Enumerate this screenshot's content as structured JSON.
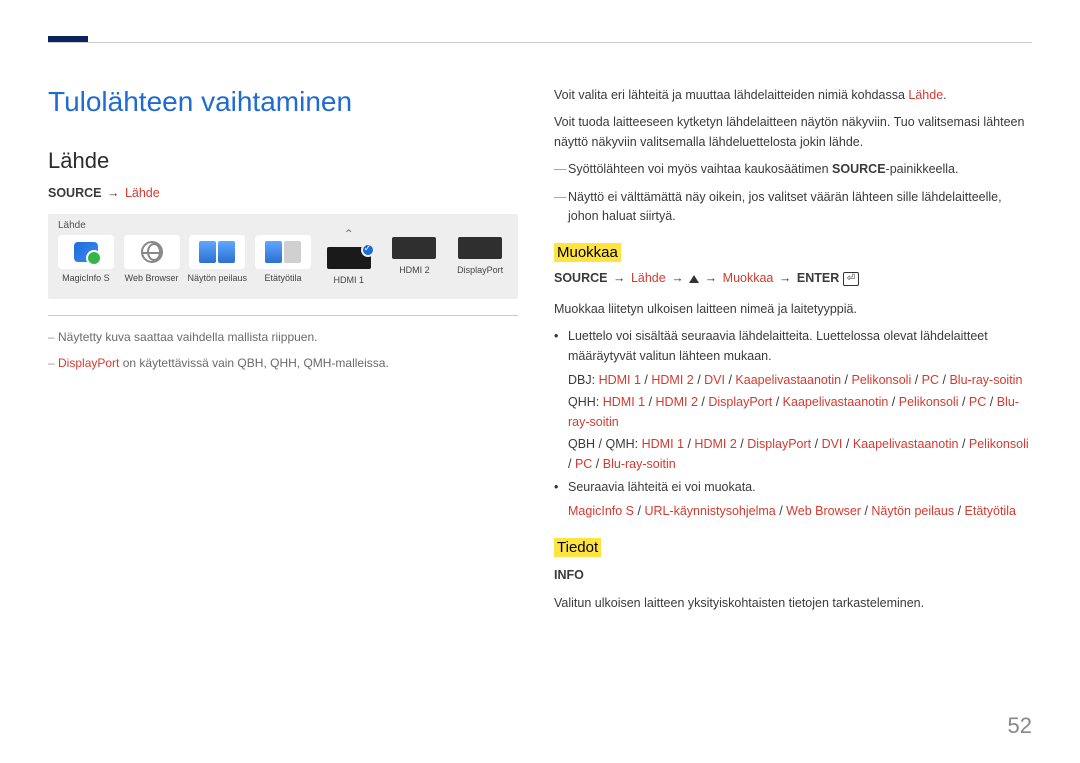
{
  "page_number": "52",
  "left": {
    "h1": "Tulolähteen vaihtaminen",
    "h2": "Lähde",
    "breadcrumb": {
      "source": "SOURCE",
      "target": "Lähde"
    },
    "panel_title": "Lähde",
    "sources": [
      {
        "label": "MagicInfo S"
      },
      {
        "label": "Web Browser"
      },
      {
        "label": "Näytön peilaus"
      },
      {
        "label": "Etätyötila"
      },
      {
        "label": "HDMI 1"
      },
      {
        "label": "HDMI 2"
      },
      {
        "label": "DisplayPort"
      }
    ],
    "notes": {
      "n1": "Näytetty kuva saattaa vaihdella mallista riippuen.",
      "n2a": "DisplayPort",
      "n2b": " on käytettävissä vain QBH, QHH, QMH-malleissa."
    }
  },
  "right": {
    "intro1a": "Voit valita eri lähteitä ja muuttaa lähdelaitteiden nimiä kohdassa ",
    "intro1b": "Lähde",
    "intro1c": ".",
    "intro2": "Voit tuoda laitteeseen kytketyn lähdelaitteen näytön näkyviin. Tuo valitsemasi lähteen näyttö näkyviin valitsemalla lähdeluettelosta jokin lähde.",
    "dash1a": "Syöttölähteen voi myös vaihtaa kaukosäätimen ",
    "dash1b": "SOURCE",
    "dash1c": "-painikkeella.",
    "dash2": "Näyttö ei välttämättä näy oikein, jos valitset väärän lähteen sille lähdelaitteelle, johon haluat siirtyä.",
    "muokkaa": {
      "title": "Muokkaa",
      "path": {
        "source": "SOURCE",
        "lahde": "Lähde",
        "muokkaa": "Muokkaa",
        "enter": "ENTER"
      },
      "desc": "Muokkaa liitetyn ulkoisen laitteen nimeä ja laitetyyppiä.",
      "b1": "Luettelo voi sisältää seuraavia lähdelaitteita. Luettelossa olevat lähdelaitteet määräytyvät valitun lähteen mukaan.",
      "dbj_label": "DBJ: ",
      "dbj_items": [
        "HDMI 1",
        "HDMI 2",
        "DVI",
        "Kaapelivastaanotin",
        "Pelikonsoli",
        "PC",
        "Blu-ray-soitin"
      ],
      "qhh_label": "QHH: ",
      "qhh_items": [
        "HDMI 1",
        "HDMI 2",
        "DisplayPort",
        "Kaapelivastaanotin",
        "Pelikonsoli",
        "PC",
        "Blu-ray-soitin"
      ],
      "qbh_label": "QBH / QMH: ",
      "qbh_items": [
        "HDMI 1",
        "HDMI 2",
        "DisplayPort",
        "DVI",
        "Kaapelivastaanotin",
        "Pelikonsoli",
        "PC",
        "Blu-ray-soitin"
      ],
      "b2": "Seuraavia lähteitä ei voi muokata.",
      "nomod_items": [
        "MagicInfo S",
        "URL-käynnistysohjelma",
        "Web Browser",
        "Näytön peilaus",
        "Etätyötila"
      ]
    },
    "tiedot": {
      "title": "Tiedot",
      "info": "INFO",
      "desc": "Valitun ulkoisen laitteen yksityiskohtaisten tietojen tarkasteleminen."
    }
  }
}
